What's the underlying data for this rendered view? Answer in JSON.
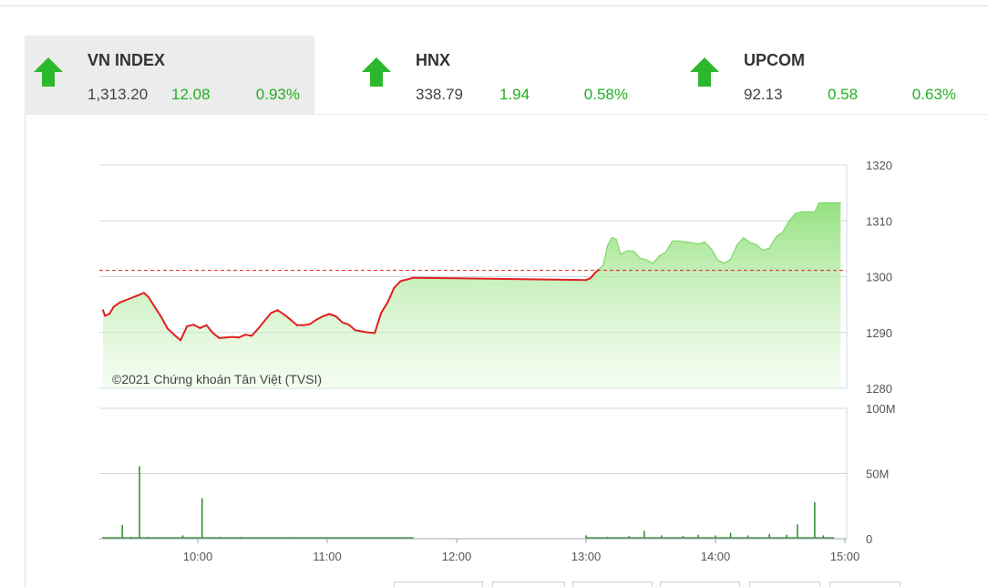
{
  "indices": [
    {
      "name": "VN INDEX",
      "value": "1,313.20",
      "change": "12.08",
      "percent": "0.93%",
      "direction": "up",
      "active": true
    },
    {
      "name": "HNX",
      "value": "338.79",
      "change": "1.94",
      "percent": "0.58%",
      "direction": "up",
      "active": false
    },
    {
      "name": "UPCOM",
      "value": "92.13",
      "change": "0.58",
      "percent": "0.63%",
      "direction": "up",
      "active": false
    }
  ],
  "colors": {
    "up": "#22b022",
    "below_ref": "#e02020",
    "ref_line": "#e02020",
    "area_fill": "#9be38a",
    "volume": "#2a8a2a"
  },
  "watermark": "©2021 Chứng khoán Tân Việt (TVSI)",
  "chart_data": [
    {
      "type": "area",
      "title": "",
      "x_unit": "time",
      "x_ticks": [
        "10:00",
        "11:00",
        "12:00",
        "13:00",
        "14:00",
        "15:00"
      ],
      "y_ticks": [
        "1280",
        "1290",
        "1300",
        "1310",
        "1320"
      ],
      "ylim": [
        1280,
        1320
      ],
      "reference_value": 1301.12,
      "grid": true,
      "series": [
        {
          "points": [
            [
              "09:15",
              1294.0
            ],
            [
              "09:17",
              1293.0
            ],
            [
              "09:19",
              1293.3
            ],
            [
              "09:21",
              1294.6
            ],
            [
              "09:24",
              1295.4
            ],
            [
              "09:28",
              1296.0
            ],
            [
              "09:32",
              1296.6
            ],
            [
              "09:35",
              1297.1
            ],
            [
              "09:37",
              1296.4
            ],
            [
              "09:40",
              1294.6
            ],
            [
              "09:43",
              1292.8
            ],
            [
              "09:46",
              1290.7
            ],
            [
              "09:49",
              1289.6
            ],
            [
              "09:52",
              1288.6
            ],
            [
              "09:55",
              1291.1
            ],
            [
              "09:58",
              1291.4
            ],
            [
              "10:01",
              1290.8
            ],
            [
              "10:04",
              1291.3
            ],
            [
              "10:07",
              1289.9
            ],
            [
              "10:10",
              1289.0
            ],
            [
              "10:13",
              1289.1
            ],
            [
              "10:16",
              1289.2
            ],
            [
              "10:19",
              1289.1
            ],
            [
              "10:22",
              1289.6
            ],
            [
              "10:25",
              1289.4
            ],
            [
              "10:28",
              1290.7
            ],
            [
              "10:31",
              1292.1
            ],
            [
              "10:34",
              1293.5
            ],
            [
              "10:37",
              1294.0
            ],
            [
              "10:40",
              1293.2
            ],
            [
              "10:43",
              1292.3
            ],
            [
              "10:46",
              1291.3
            ],
            [
              "10:49",
              1291.3
            ],
            [
              "10:52",
              1291.5
            ],
            [
              "10:55",
              1292.3
            ],
            [
              "10:58",
              1292.9
            ],
            [
              "11:01",
              1293.3
            ],
            [
              "11:04",
              1292.9
            ],
            [
              "11:07",
              1291.8
            ],
            [
              "11:10",
              1291.4
            ],
            [
              "11:13",
              1290.4
            ],
            [
              "11:16",
              1290.2
            ],
            [
              "11:19",
              1290.0
            ],
            [
              "11:22",
              1289.9
            ],
            [
              "11:25",
              1293.5
            ],
            [
              "11:28",
              1295.4
            ],
            [
              "11:31",
              1298.0
            ],
            [
              "11:34",
              1299.2
            ],
            [
              "11:37",
              1299.5
            ],
            [
              "11:40",
              1299.8
            ],
            [
              "13:00",
              1299.4
            ],
            [
              "13:02",
              1299.7
            ],
            [
              "13:04",
              1300.6
            ],
            [
              "13:06",
              1301.3
            ],
            [
              "13:08",
              1302.1
            ],
            [
              "13:10",
              1305.6
            ],
            [
              "13:12",
              1307.0
            ],
            [
              "13:14",
              1306.7
            ],
            [
              "13:16",
              1304.0
            ],
            [
              "13:19",
              1304.6
            ],
            [
              "13:22",
              1304.6
            ],
            [
              "13:25",
              1303.3
            ],
            [
              "13:28",
              1303.0
            ],
            [
              "13:31",
              1302.4
            ],
            [
              "13:34",
              1303.7
            ],
            [
              "13:37",
              1304.4
            ],
            [
              "13:40",
              1306.4
            ],
            [
              "13:43",
              1306.4
            ],
            [
              "13:46",
              1306.2
            ],
            [
              "13:49",
              1306.1
            ],
            [
              "13:52",
              1305.8
            ],
            [
              "13:55",
              1306.2
            ],
            [
              "13:58",
              1305.0
            ],
            [
              "14:01",
              1303.0
            ],
            [
              "14:04",
              1302.4
            ],
            [
              "14:07",
              1303.1
            ],
            [
              "14:10",
              1305.7
            ],
            [
              "14:13",
              1307.0
            ],
            [
              "14:16",
              1306.1
            ],
            [
              "14:19",
              1305.7
            ],
            [
              "14:22",
              1304.7
            ],
            [
              "14:25",
              1305.1
            ],
            [
              "14:28",
              1307.1
            ],
            [
              "14:31",
              1307.9
            ],
            [
              "14:34",
              1309.9
            ],
            [
              "14:37",
              1311.3
            ],
            [
              "14:40",
              1311.6
            ],
            [
              "14:43",
              1311.6
            ],
            [
              "14:46",
              1311.6
            ],
            [
              "14:48",
              1313.2
            ],
            [
              "14:55",
              1313.2
            ],
            [
              "14:58",
              1313.2
            ]
          ]
        }
      ]
    },
    {
      "type": "bar",
      "title": "",
      "x_ticks": [
        "10:00",
        "11:00",
        "12:00",
        "13:00",
        "14:00",
        "15:00"
      ],
      "y_ticks": [
        "0",
        "50M",
        "100M"
      ],
      "ylim": [
        0,
        100
      ],
      "y_unit": "M",
      "series": [
        {
          "points": [
            [
              "09:15",
              1.2
            ],
            [
              "09:25",
              10.5
            ],
            [
              "09:29",
              1.5
            ],
            [
              "09:33",
              55.5
            ],
            [
              "09:37",
              1.5
            ],
            [
              "09:41",
              1.2
            ],
            [
              "09:45",
              1.0
            ],
            [
              "09:49",
              1.0
            ],
            [
              "09:53",
              2.5
            ],
            [
              "09:57",
              1.0
            ],
            [
              "10:02",
              31.0
            ],
            [
              "10:06",
              1.3
            ],
            [
              "10:10",
              1.5
            ],
            [
              "10:20",
              1.3
            ],
            [
              "10:30",
              1.0
            ],
            [
              "10:45",
              1.2
            ],
            [
              "11:00",
              1.0
            ],
            [
              "11:15",
              1.1
            ],
            [
              "11:30",
              0.8
            ],
            [
              "13:00",
              2.5
            ],
            [
              "13:10",
              1.5
            ],
            [
              "13:20",
              2.0
            ],
            [
              "13:27",
              6.0
            ],
            [
              "13:35",
              2.5
            ],
            [
              "13:45",
              2.0
            ],
            [
              "13:52",
              3.0
            ],
            [
              "14:00",
              2.5
            ],
            [
              "14:07",
              4.5
            ],
            [
              "14:15",
              2.5
            ],
            [
              "14:25",
              3.5
            ],
            [
              "14:33",
              3.0
            ],
            [
              "14:38",
              11.0
            ],
            [
              "14:46",
              28.0
            ],
            [
              "14:50",
              2.5
            ]
          ]
        }
      ]
    }
  ]
}
